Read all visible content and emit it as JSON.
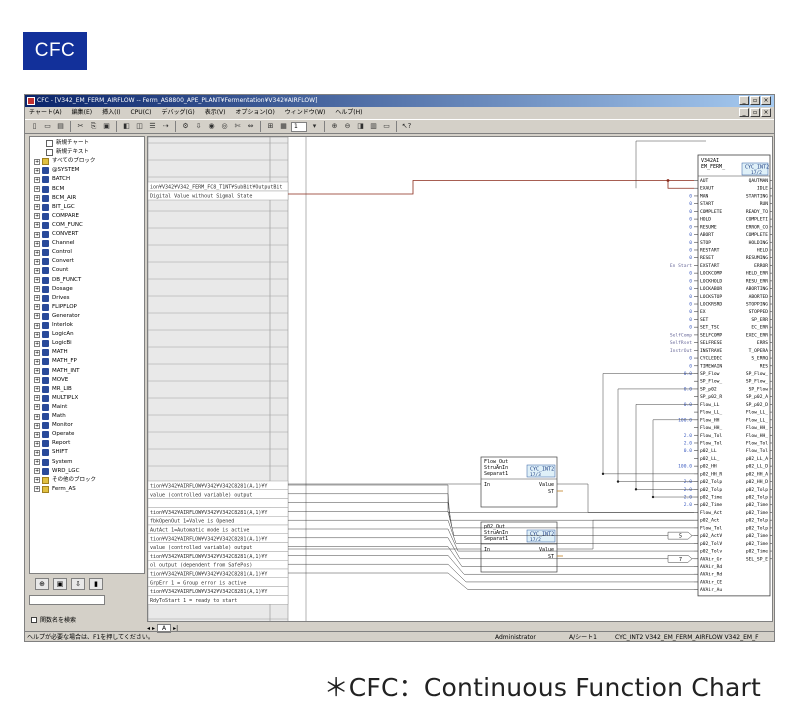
{
  "badge": "CFC",
  "caption": "＊CFC：Continuous Function Chart",
  "window": {
    "title": "CFC - [V342_EM_FERM_AIRFLOW -- Ferm_AS8800_APE_PLANT¥Fermentation¥V342¥AIRFLOW]",
    "menu": [
      "チャート(A)",
      "編集(E)",
      "挿入(I)",
      "CPU(C)",
      "デバッグ(G)",
      "表示(V)",
      "オプション(O)",
      "ウィンドウ(W)",
      "ヘルプ(H)"
    ],
    "toolbar_page_value": "1"
  },
  "tree": {
    "items": [
      {
        "label": "新規チャート",
        "icon": "doc"
      },
      {
        "label": "新規テキスト",
        "icon": "doc"
      },
      {
        "label": "すべてのブロック",
        "icon": "fold"
      },
      {
        "label": "@SYSTEM",
        "icon": "lib"
      },
      {
        "label": "BATCH",
        "icon": "lib"
      },
      {
        "label": "BCM",
        "icon": "lib"
      },
      {
        "label": "BCM_AIR",
        "icon": "lib"
      },
      {
        "label": "BIT_LGC",
        "icon": "lib"
      },
      {
        "label": "COMPARE",
        "icon": "lib"
      },
      {
        "label": "COM_FUNC",
        "icon": "lib"
      },
      {
        "label": "CONVERT",
        "icon": "lib"
      },
      {
        "label": "Channel",
        "icon": "lib"
      },
      {
        "label": "Control",
        "icon": "lib"
      },
      {
        "label": "Convert",
        "icon": "lib"
      },
      {
        "label": "Count",
        "icon": "lib"
      },
      {
        "label": "DB_FUNCT",
        "icon": "lib"
      },
      {
        "label": "Dosage",
        "icon": "lib"
      },
      {
        "label": "Drives",
        "icon": "lib"
      },
      {
        "label": "FLIPFLOP",
        "icon": "lib"
      },
      {
        "label": "Generator",
        "icon": "lib"
      },
      {
        "label": "Interlok",
        "icon": "lib"
      },
      {
        "label": "LogicAn",
        "icon": "lib"
      },
      {
        "label": "LogicBi",
        "icon": "lib"
      },
      {
        "label": "MATH",
        "icon": "lib"
      },
      {
        "label": "MATH_FP",
        "icon": "lib"
      },
      {
        "label": "MATH_INT",
        "icon": "lib"
      },
      {
        "label": "MOVE",
        "icon": "lib"
      },
      {
        "label": "MR_LIB",
        "icon": "lib"
      },
      {
        "label": "MULTIPLX",
        "icon": "lib"
      },
      {
        "label": "Maint",
        "icon": "lib"
      },
      {
        "label": "Math",
        "icon": "lib"
      },
      {
        "label": "Monitor",
        "icon": "lib"
      },
      {
        "label": "Operate",
        "icon": "lib"
      },
      {
        "label": "Report",
        "icon": "lib"
      },
      {
        "label": "SHIFT",
        "icon": "lib"
      },
      {
        "label": "System",
        "icon": "lib"
      },
      {
        "label": "WRD_LGC",
        "icon": "lib"
      },
      {
        "label": "その他のブロック",
        "icon": "fold"
      },
      {
        "label": "Ferm_AS",
        "icon": "fold"
      }
    ],
    "checkbox_label": "関数名を検索"
  },
  "left_sheet": {
    "rows_top": [
      "ion¥V342¥V342_FERM_FC8_T1NT¥SubBit¥OutputBit",
      "Digital Value without Sigmal State"
    ],
    "rows_bottom": [
      "tion¥V342¥AIRFLOW¥V342¥V342C8281(A,1)¥Y",
      "value (controlled variable) output",
      "",
      "tion¥V342¥AIRFLOW¥V342¥V342C8281(A,1)¥Y",
      "fbkOpenOut 1=Valve is Opened",
      "AutAct 1=Automatic mode is active",
      "tion¥V342¥AIRFLOW¥V342¥V342C8281(A,1)¥Y",
      "value (controlled variable) output",
      "tion¥V342¥AIRFLOW¥V342¥V342C8281(A,1)¥Y",
      "ol output (dependent from SafePos)",
      "tion¥V342¥AIRFLOW¥V342¥V342C8281(A,1)¥Y",
      "GrpErr 1 = Group error is active",
      "tion¥V342¥AIRFLOW¥V342¥V342C8281(A,1)¥Y",
      "RdyToStart 1 = ready to start"
    ]
  },
  "mid_blocks": [
    {
      "name": "Flow_Out",
      "type1": "StruAnIn",
      "type2": "Separat1",
      "fb": "CYC_INT2",
      "num": "17/3",
      "in": "In",
      "out1": "Value",
      "out2": "ST"
    },
    {
      "name": "p02_Out",
      "type1": "StruAnIn",
      "type2": "Separat1",
      "fb": "CYC_INT2",
      "num": "17/2",
      "in": "In",
      "out1": "Value",
      "out2": "ST"
    }
  ],
  "main_block": {
    "name": "V342AI",
    "name2": "EM_FERM_",
    "fb": "CYC_INT2",
    "num": "17/2",
    "inputs": [
      "AUT",
      "EXAUT",
      "MAN",
      "START",
      "COMPLETE",
      "HOLD",
      "RESUME",
      "ABORT",
      "STOP",
      "RESTART",
      "RESET",
      "EXSTART",
      "LOCKCOMP",
      "LOCKHOLD",
      "LOCKABOR",
      "LOCKSTOP",
      "LOCKRSRD",
      "EX",
      "SET",
      "SET_TSC",
      "SELFCOMP",
      "SELFRESE",
      "INSTRAVE",
      "CYCLEDEC",
      "TIMEWAIN",
      "SP_Flow",
      "SP_Flow_",
      "SP_p02",
      "SP_p02_R",
      "Flow_LL",
      "Flow_LL_",
      "Flow_HH",
      "Flow_HH_",
      "Flow_Tol",
      "Flow_Tol",
      "p02_LL",
      "p02_LL_",
      "p02_HH",
      "p02_HH_R",
      "p02_Tolp",
      "p02_Tolp",
      "p02_Time",
      "p02_Time",
      "Flow_Act",
      "p02_Act",
      "Flow_Tol",
      "p02_ActV",
      "p02_TolV",
      "p02_Tolv",
      "AVAir_Gr",
      "AVAir_Rd",
      "AVAir_Rd",
      "AVAir_CE",
      "AVAir_Au"
    ],
    "outputs": [
      "QAUTMAN",
      "IDLE",
      "STARTING",
      "RUN",
      "READY_TO",
      "COMPLETI",
      "ERROR_CO",
      "COMPLETE",
      "HOLDING",
      "HELD",
      "RESUMING",
      "ERROR",
      "HELD_ERR",
      "RESU_ERR",
      "ABORTING",
      "ABORTED",
      "STOPPING",
      "STOPPED",
      "SP_ERR",
      "EC_ERR",
      "EXEC_ERR",
      "ERRS",
      "T_OPERA",
      "S_ERRQ",
      "RES",
      "SP_Flow_",
      "SP_Flow_",
      "SP_Flow",
      "SP_p02_A",
      "SP_p02_D",
      "Flow_LL_",
      "Flow_LL_",
      "Flow_HH_",
      "Flow_HH_",
      "Flow_Tol",
      "Flow_Tol",
      "p02_LL_A",
      "p02_LL_D",
      "p02_HH_A",
      "p02_HH_D",
      "p02_Tolp",
      "p02_Tolp",
      "p02_Time",
      "p02_Time",
      "p02_Tolp",
      "p02_Tolp",
      "p02_Time",
      "p02_Time",
      "p02_Time",
      "SEL_SP_E"
    ],
    "left_values": [
      "",
      "",
      "0",
      "0",
      "0",
      "0",
      "0",
      "0",
      "0",
      "0",
      "0",
      "En Start",
      "0",
      "0",
      "0",
      "0",
      "0",
      "0",
      "0",
      "0",
      "SelfComp",
      "SelfRset",
      "InstrOut",
      "0",
      "0",
      "0.0",
      "",
      "0.0",
      "",
      "0.0",
      "",
      "100.0",
      "",
      "2.0",
      "2.0",
      "0.0",
      "",
      "100.0",
      "",
      "2.0",
      "2.0",
      "2.0",
      "2.0",
      "",
      "",
      "",
      "",
      "",
      "",
      "",
      "",
      "",
      "",
      ""
    ]
  },
  "input_boxes": [
    "5",
    "7"
  ],
  "sheet_tabs": [
    "A"
  ],
  "status": {
    "help": "ヘルプが必要な場合は、F1を押してください。",
    "user": "Administrator",
    "sheet": "A/シート1",
    "path": "CYC_INT2 V342_EM_FERM_AIRFLOW V342_EM_F"
  }
}
